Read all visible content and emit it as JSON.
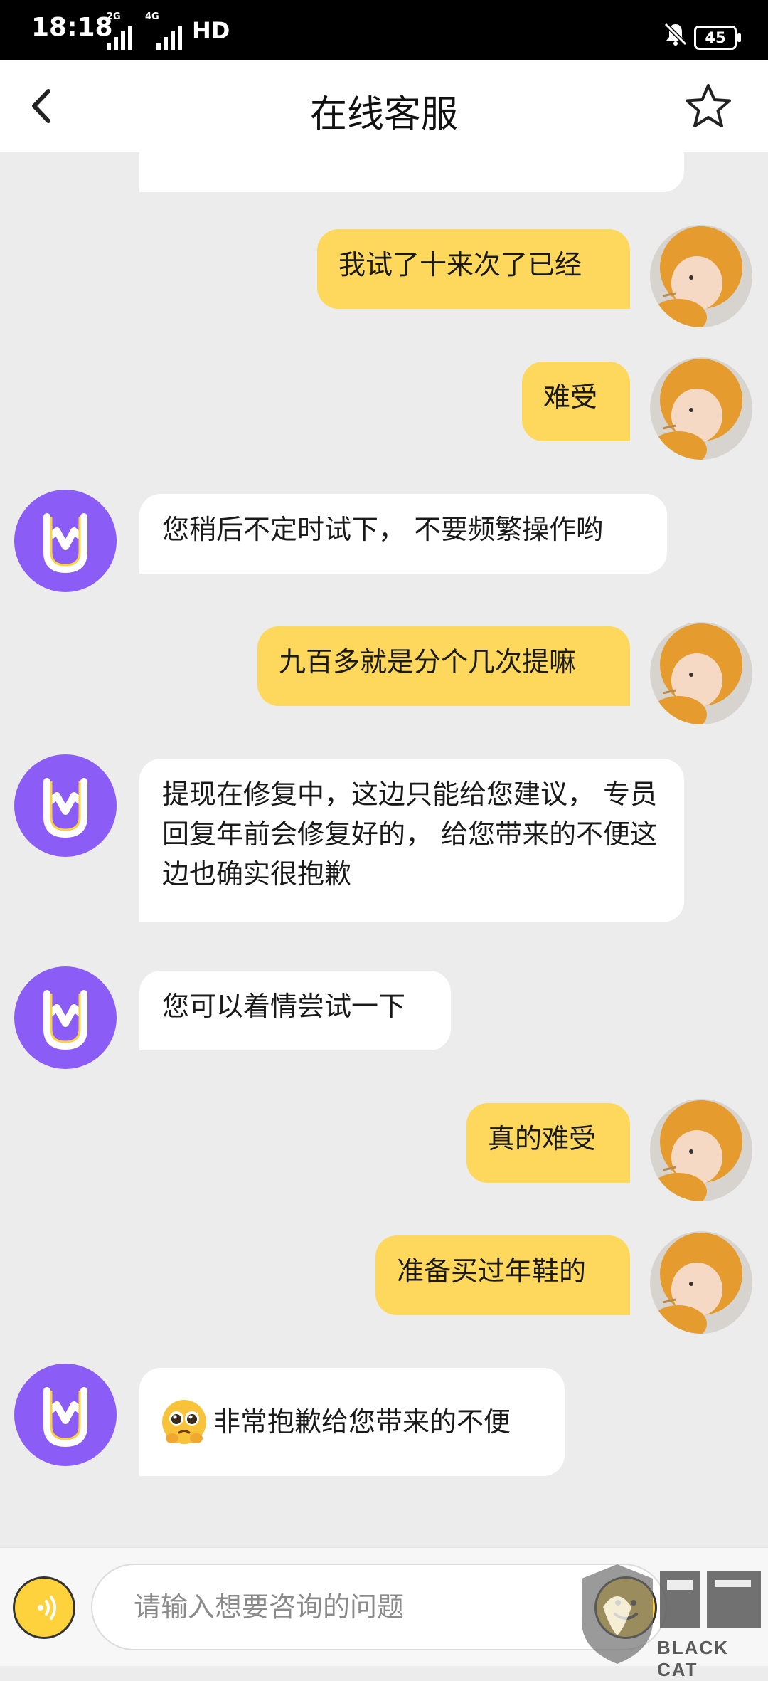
{
  "status_bar": {
    "time": "18:18",
    "sim1_tag": "2G",
    "sim2_tag": "4G",
    "hd_label": "HD",
    "battery": "45"
  },
  "header": {
    "title": "在线客服",
    "back_icon": "chevron-left-icon",
    "favorite_icon": "star-outline-icon"
  },
  "messages": [
    {
      "sender": "user",
      "text": "我试了十来次了已经"
    },
    {
      "sender": "user",
      "text": "难受"
    },
    {
      "sender": "agent",
      "text": "您稍后不定时试下， 不要频繁操作哟"
    },
    {
      "sender": "user",
      "text": "九百多就是分个几次提嘛"
    },
    {
      "sender": "agent",
      "text": "提现在修复中，这边只能给您建议， 专员回复年前会修复好的， 给您带来的不便这边也确实很抱歉"
    },
    {
      "sender": "agent",
      "text": "您可以着情尝试一下"
    },
    {
      "sender": "user",
      "text": "真的难受"
    },
    {
      "sender": "user",
      "text": "准备买过年鞋的"
    },
    {
      "sender": "agent",
      "emoji": "pleading-face-emoji",
      "text": "非常抱歉给您带来的不便"
    }
  ],
  "input": {
    "placeholder": "请输入想要咨询的问题",
    "voice_icon": "voice-icon",
    "emoji_icon": "emoji-icon"
  },
  "watermark": {
    "text": "BLACK CAT"
  },
  "colors": {
    "user_bubble": "#fdd85d",
    "agent_bubble": "#ffffff",
    "agent_avatar": "#8b5cf6",
    "background": "#ececec"
  }
}
